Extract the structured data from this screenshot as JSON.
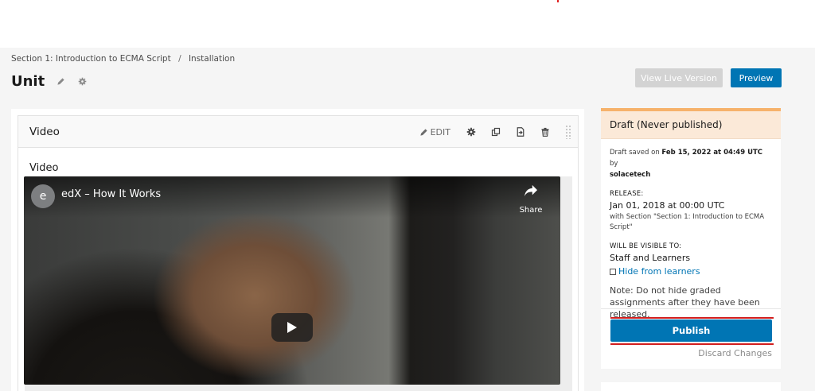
{
  "breadcrumb": {
    "section": "Section 1: Introduction to ECMA Script",
    "separator": "/",
    "subsection": "Installation"
  },
  "unit": {
    "title": "Unit",
    "edit_icon": "pencil-icon",
    "settings_icon": "gear-icon"
  },
  "header_actions": {
    "view_live_label": "View Live Version",
    "preview_label": "Preview"
  },
  "xblock": {
    "title": "Video",
    "edit_label": "EDIT",
    "action_icons": [
      "gear-icon",
      "duplicate-icon",
      "move-icon",
      "trash-icon",
      "drag-handle-icon"
    ],
    "display_name": "Video"
  },
  "player": {
    "channel_letter": "e",
    "video_title": "edX – How It Works",
    "share_label": "Share",
    "play_icon": "play-icon"
  },
  "sidebar": {
    "status_title": "Draft (Never published)",
    "saved_prefix": "Draft saved on",
    "saved_date": "Feb 15, 2022 at 04:49 UTC",
    "saved_by_prefix": "by",
    "saved_by": "solacetech",
    "release_label": "RELEASE:",
    "release_date": "Jan 01, 2018 at 00:00 UTC",
    "release_note": "with Section \"Section 1: Introduction to ECMA Script\"",
    "visible_label": "WILL BE VISIBLE TO:",
    "visible_value": "Staff and Learners",
    "hide_label": "Hide from learners",
    "hide_checked": false,
    "note": "Note: Do not hide graded assignments after they have been released.",
    "publish_label": "Publish",
    "discard_label": "Discard Changes"
  },
  "colors": {
    "primary": "#0075b4",
    "draft_accent": "#f6b26b",
    "draft_bg": "#fbe9d8",
    "annotation_red": "#d11e1e",
    "disabled_button": "#d3d3d3"
  }
}
